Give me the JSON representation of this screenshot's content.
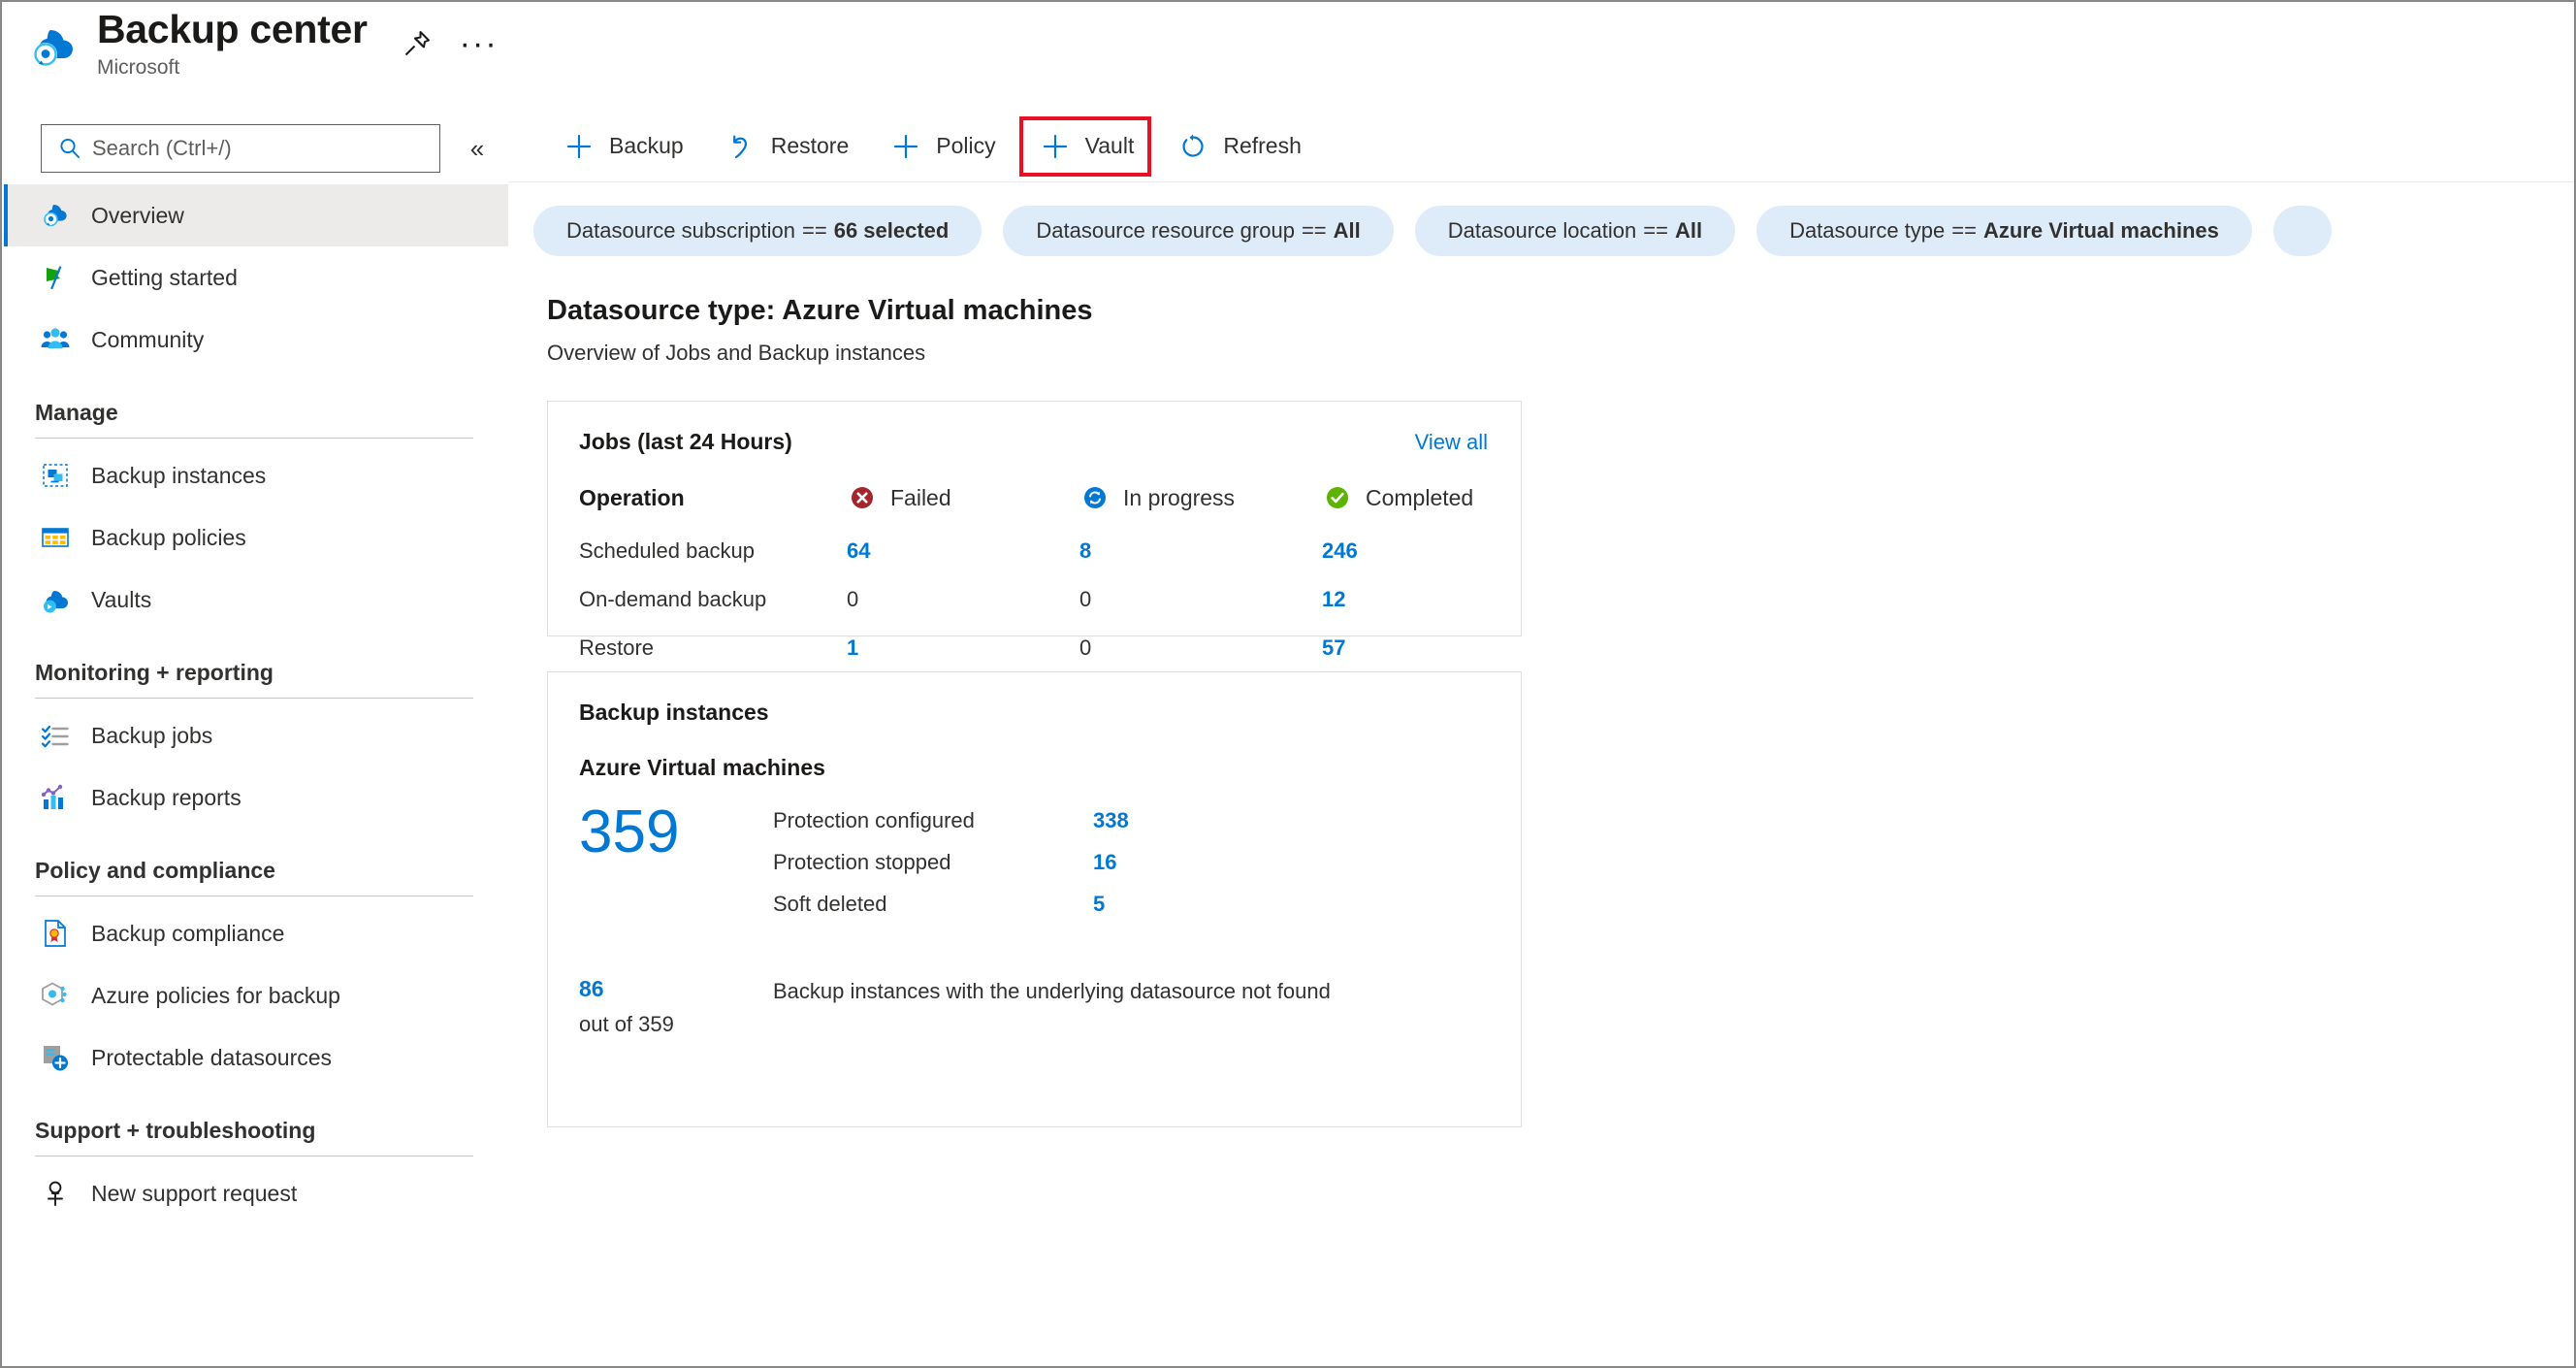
{
  "header": {
    "title": "Backup center",
    "subtitle": "Microsoft",
    "logo_icon": "backup-cloud-icon",
    "pin_icon": "pin-icon",
    "more_icon": "ellipsis-icon"
  },
  "search": {
    "placeholder": "Search (Ctrl+/)",
    "value": "",
    "icon": "search-icon",
    "collapse_icon": "double-chevron-left-icon"
  },
  "sidebar": {
    "top_items": [
      {
        "label": "Overview",
        "icon": "backup-cloud-icon",
        "selected": true
      },
      {
        "label": "Getting started",
        "icon": "flag-icon",
        "selected": false
      },
      {
        "label": "Community",
        "icon": "people-icon",
        "selected": false
      }
    ],
    "groups": [
      {
        "title": "Manage",
        "items": [
          {
            "label": "Backup instances",
            "icon": "backup-instance-icon"
          },
          {
            "label": "Backup policies",
            "icon": "policy-table-icon"
          },
          {
            "label": "Vaults",
            "icon": "vault-cloud-icon"
          }
        ]
      },
      {
        "title": "Monitoring + reporting",
        "items": [
          {
            "label": "Backup jobs",
            "icon": "checklist-icon"
          },
          {
            "label": "Backup reports",
            "icon": "bar-chart-icon"
          }
        ]
      },
      {
        "title": "Policy and compliance",
        "items": [
          {
            "label": "Backup compliance",
            "icon": "certificate-document-icon"
          },
          {
            "label": "Azure policies for backup",
            "icon": "azure-policy-icon"
          },
          {
            "label": "Protectable datasources",
            "icon": "server-add-icon"
          }
        ]
      },
      {
        "title": "Support + troubleshooting",
        "items": [
          {
            "label": "New support request",
            "icon": "support-person-icon"
          }
        ]
      }
    ]
  },
  "toolbar": {
    "buttons": [
      {
        "label": "Backup",
        "icon": "plus-icon",
        "highlighted": false
      },
      {
        "label": "Restore",
        "icon": "restore-arrow-icon",
        "highlighted": false
      },
      {
        "label": "Policy",
        "icon": "plus-icon",
        "highlighted": false
      },
      {
        "label": "Vault",
        "icon": "plus-icon",
        "highlighted": true
      },
      {
        "label": "Refresh",
        "icon": "refresh-icon",
        "highlighted": false
      }
    ]
  },
  "filters": [
    {
      "key": "Datasource subscription",
      "op": "==",
      "value": "66 selected"
    },
    {
      "key": "Datasource resource group",
      "op": "==",
      "value": "All"
    },
    {
      "key": "Datasource location",
      "op": "==",
      "value": "All"
    },
    {
      "key": "Datasource type",
      "op": "==",
      "value": "Azure Virtual machines"
    }
  ],
  "page": {
    "title": "Datasource type: Azure Virtual machines",
    "subtitle": "Overview of Jobs and Backup instances"
  },
  "jobs_card": {
    "title": "Jobs (last 24 Hours)",
    "view_all": "View all",
    "columns": [
      {
        "label": "Operation",
        "icon": null
      },
      {
        "label": "Failed",
        "icon": "error-circle-icon",
        "color": "#a4262c"
      },
      {
        "label": "In progress",
        "icon": "sync-circle-icon",
        "color": "#0078d4"
      },
      {
        "label": "Completed",
        "icon": "success-circle-icon",
        "color": "#107c10"
      }
    ],
    "rows": [
      {
        "operation": "Scheduled backup",
        "failed": "64",
        "in_progress": "8",
        "completed": "246"
      },
      {
        "operation": "On-demand backup",
        "failed": "0",
        "in_progress": "0",
        "completed": "12"
      },
      {
        "operation": "Restore",
        "failed": "1",
        "in_progress": "0",
        "completed": "57"
      }
    ]
  },
  "instances_card": {
    "title": "Backup instances",
    "datasource_type": "Azure Virtual machines",
    "total": "359",
    "rows": [
      {
        "label": "Protection configured",
        "value": "338"
      },
      {
        "label": "Protection stopped",
        "value": "16"
      },
      {
        "label": "Soft deleted",
        "value": "5"
      }
    ],
    "footer": {
      "count": "86",
      "out_of": "out of 359",
      "text": "Backup instances with the underlying datasource not found"
    }
  },
  "colors": {
    "accent": "#0078d4",
    "pill_bg": "#deecf9",
    "highlight_border": "#e81123",
    "failed": "#a4262c",
    "completed": "#107c10",
    "selected_bg": "#edebe9"
  },
  "chart_data": {
    "type": "table",
    "title": "Jobs (last 24 Hours)",
    "categories": [
      "Scheduled backup",
      "On-demand backup",
      "Restore"
    ],
    "series": [
      {
        "name": "Failed",
        "values": [
          64,
          0,
          1
        ]
      },
      {
        "name": "In progress",
        "values": [
          8,
          0,
          0
        ]
      },
      {
        "name": "Completed",
        "values": [
          246,
          12,
          57
        ]
      }
    ]
  }
}
